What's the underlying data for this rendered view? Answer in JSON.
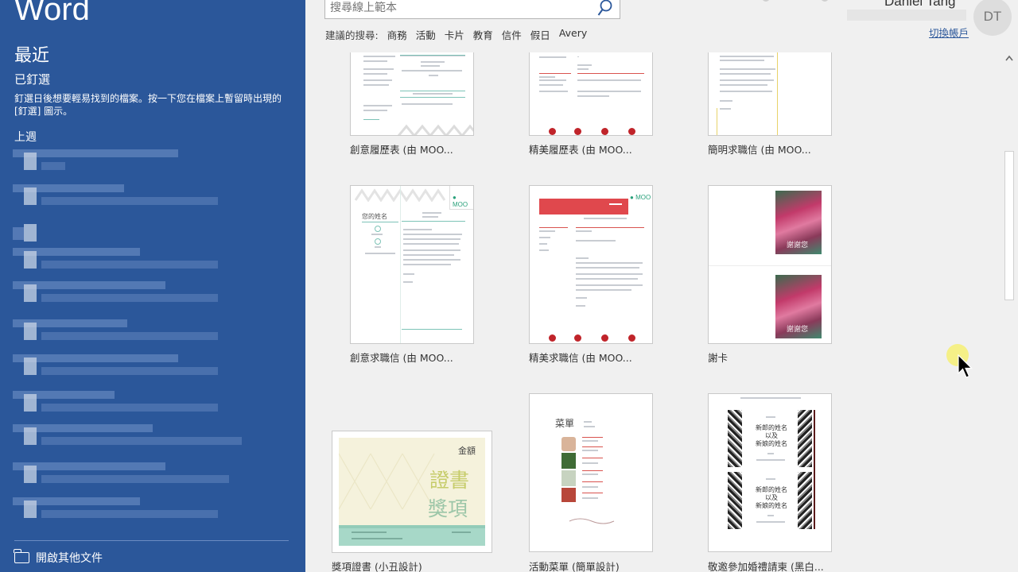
{
  "left": {
    "app_title": "Word",
    "recent_title": "最近",
    "pinned_title": "已釘選",
    "pinned_desc": "釘選日後想要輕易找到的檔案。按一下您在檔案上暫留時出現的 [釘選] 圖示。",
    "last_week": "上週",
    "open_other": "開啟其他文件"
  },
  "search": {
    "placeholder": "搜尋線上範本",
    "suggest_label": "建議的搜尋:",
    "suggestions": [
      "商務",
      "活動",
      "卡片",
      "教育",
      "信件",
      "假日",
      "Avery"
    ]
  },
  "account": {
    "name": "Daniel Tang",
    "switch": "切換帳戶",
    "initials": "DT"
  },
  "templates": [
    {
      "name": "創意履歷表 (由 MOO..."
    },
    {
      "name": "精美履歷表 (由 MOO..."
    },
    {
      "name": "簡明求職信 (由 MOO..."
    },
    {
      "name": "創意求職信 (由 MOO..."
    },
    {
      "name": "精美求職信 (由 MOO..."
    },
    {
      "name": "謝卡"
    },
    {
      "name": "獎項證書 (小丑設計)"
    },
    {
      "name": "活動菜單 (簡單設計)"
    },
    {
      "name": "敬邀參加婚禮請柬 (黑白..."
    }
  ],
  "thumb_text": {
    "moo": "MOO",
    "your_name": "您的姓名",
    "gold": "金額",
    "certificate": "證書",
    "award": "獎項",
    "menu": "菜單",
    "bride_groom": "新郎的姓名",
    "and": "以及",
    "bride": "新娘的姓名",
    "thanks": "謝謝您"
  },
  "colors": {
    "sidebar": "#2b579a",
    "accent_red": "#d9534f",
    "accent_teal": "#7dc3b7"
  }
}
